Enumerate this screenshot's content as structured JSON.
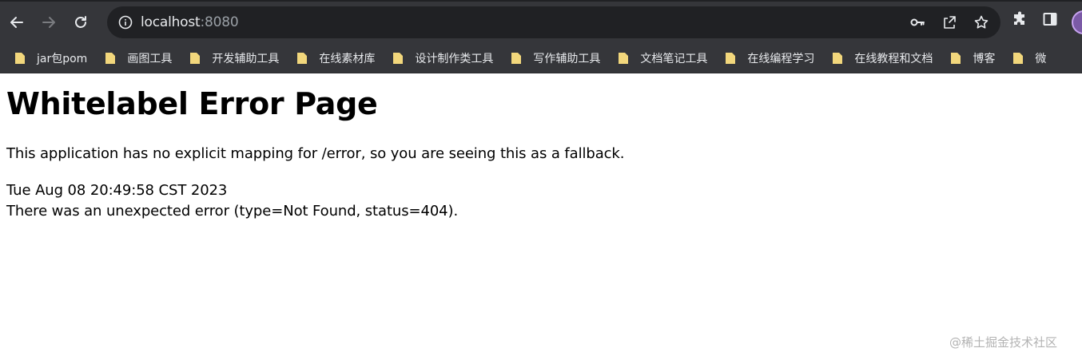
{
  "browser": {
    "url_host": "localhost",
    "url_port": ":8080",
    "icons": {
      "back": "arrow-left-icon",
      "forward": "arrow-right-icon",
      "reload": "reload-icon",
      "site_info": "info-icon",
      "passwords": "key-icon",
      "share": "share-icon",
      "bookmark_star": "star-icon",
      "extensions": "puzzle-icon",
      "side_panel": "side-panel-icon"
    },
    "colors": {
      "chrome_bg": "#35363a",
      "omnibox_bg": "#202124",
      "text": "#e8eaed",
      "muted": "#9aa0a6",
      "folder": "#f2d77c"
    }
  },
  "bookmarks": [
    {
      "label": "jar包pom"
    },
    {
      "label": "画图工具"
    },
    {
      "label": "开发辅助工具"
    },
    {
      "label": "在线素材库"
    },
    {
      "label": "设计制作类工具"
    },
    {
      "label": "写作辅助工具"
    },
    {
      "label": "文档笔记工具"
    },
    {
      "label": "在线编程学习"
    },
    {
      "label": "在线教程和文档"
    },
    {
      "label": "博客"
    },
    {
      "label": "微"
    }
  ],
  "page": {
    "title": "Whitelabel Error Page",
    "description": "This application has no explicit mapping for /error, so you are seeing this as a fallback.",
    "timestamp": "Tue Aug 08 20:49:58 CST 2023",
    "error_message": "There was an unexpected error (type=Not Found, status=404)."
  },
  "watermark": "@稀土掘金技术社区"
}
